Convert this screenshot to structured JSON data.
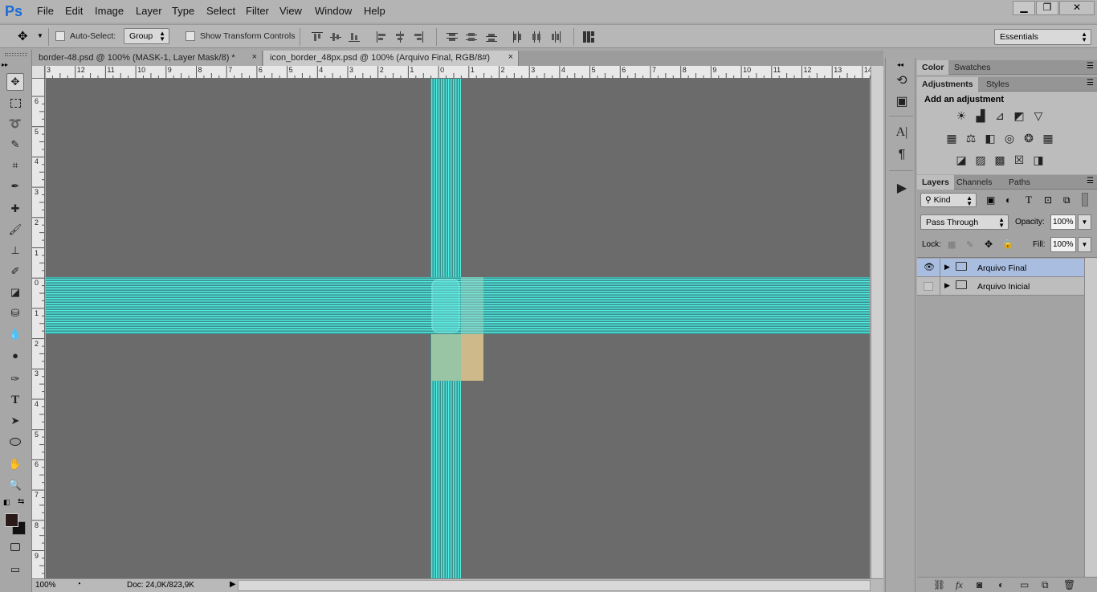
{
  "app": {
    "logo": "Ps"
  },
  "menu": [
    "File",
    "Edit",
    "Image",
    "Layer",
    "Type",
    "Select",
    "Filter",
    "View",
    "Window",
    "Help"
  ],
  "window_controls": {
    "minimize": "▁",
    "restore": "❐",
    "close": "✕"
  },
  "options": {
    "auto_select_label": "Auto-Select:",
    "auto_select_value": "Group",
    "transform_label": "Show Transform Controls",
    "workspace": "Essentials"
  },
  "tabs": [
    {
      "label": "border-48.psd @ 100% (MASK-1, Layer Mask/8) *",
      "close": "×"
    },
    {
      "label": "icon_border_48px.psd @ 100% (Arquivo Final, RGB/8#)",
      "close": "×"
    }
  ],
  "ruler_top": [
    "3",
    "12",
    "11",
    "10",
    "9",
    "8",
    "7",
    "6",
    "5",
    "4",
    "3",
    "2",
    "1",
    "0",
    "1",
    "2",
    "3",
    "4",
    "5",
    "6",
    "7",
    "8",
    "9",
    "10",
    "11",
    "12",
    "13",
    "14"
  ],
  "ruler_left": [
    "6",
    "5",
    "4",
    "3",
    "2",
    "1",
    "0",
    "1",
    "2",
    "3",
    "4",
    "5",
    "6",
    "7",
    "8",
    "9"
  ],
  "status": {
    "zoom": "100%",
    "doc": "Doc: 24,0K/823,9K"
  },
  "panels": {
    "top_tabs": [
      "Color",
      "Swatches"
    ],
    "adj_tabs": [
      "Adjustments",
      "Styles"
    ],
    "add_adjustment": "Add an adjustment",
    "layer_tabs": [
      "Layers",
      "Channels",
      "Paths"
    ],
    "kind": "Kind",
    "blend_mode": "Pass Through",
    "opacity_label": "Opacity:",
    "opacity": "100%",
    "lock_label": "Lock:",
    "fill_label": "Fill:",
    "fill": "100%"
  },
  "layers": [
    {
      "name": "Arquivo Final",
      "visible": true,
      "selected": true
    },
    {
      "name": "Arquivo Inicial",
      "visible": false,
      "selected": false
    }
  ],
  "colors": {
    "accent_cyan": "#46e0d8",
    "canvas_bg": "#6b6b6b",
    "selection_blue": "#a9bde0"
  }
}
